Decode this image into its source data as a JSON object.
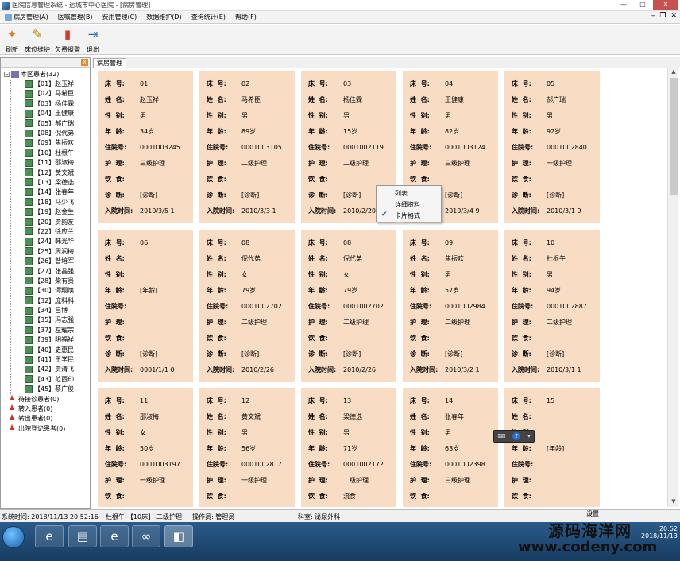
{
  "window": {
    "title": "医院信息管理系统 - 运城市中心医院 - [病房管理]"
  },
  "menu": [
    {
      "label": "病房管理(A)"
    },
    {
      "label": "医嘱管理(B)"
    },
    {
      "label": "费用管理(C)"
    },
    {
      "label": "数据维护(D)"
    },
    {
      "label": "查询统计(E)"
    },
    {
      "label": "帮助(F)"
    }
  ],
  "toolbar": [
    {
      "label": "刷新",
      "icon": "refresh-icon"
    },
    {
      "label": "床位维护",
      "icon": "bed-maintain-icon"
    },
    {
      "label": "欠费报警",
      "icon": "alarm-icon"
    },
    {
      "label": "退出",
      "icon": "exit-icon"
    }
  ],
  "tree": {
    "root": "本区患者(32)",
    "patients": [
      "【01】赵玉祥",
      "【02】马希臣",
      "【03】杨佳霖",
      "【04】王健康",
      "【05】郝广瑞",
      "【08】倪代弟",
      "【09】焦振欢",
      "【10】杜根午",
      "【11】邵淑梅",
      "【12】黄文斌",
      "【13】梁德选",
      "【14】张春年",
      "【18】马少飞",
      "【19】赵金生",
      "【20】贾韵友",
      "【22】徐应兰",
      "【24】韩光华",
      "【25】周润梅",
      "【26】昝培军",
      "【27】张晶强",
      "【28】柴有贵",
      "【30】谭翔焕",
      "【32】庞科科",
      "【34】吕博",
      "【35】冯志强",
      "【37】左耀宗",
      "【39】阴福祥",
      "【40】史惠民",
      "【41】王学民",
      "【42】贾清飞",
      "【43】范西印",
      "【45】蔡广俊"
    ],
    "groups": [
      "待接诊患者(0)",
      "转入患者(0)",
      "转出患者(0)",
      "出院登记患者(0)"
    ]
  },
  "tab": {
    "label": "病房管理"
  },
  "labels": {
    "bed": "床  号:",
    "name": "姓  名:",
    "gender": "性  别:",
    "age": "年  龄:",
    "inpatient_no": "住院号:",
    "nursing": "护  理:",
    "diet": "饮  食:",
    "diagnosis": "诊  断:",
    "admit_time": "入院时间:"
  },
  "cards": [
    {
      "bed": "01",
      "name": "赵玉祥",
      "gender": "男",
      "age": "34岁",
      "inpatient_no": "0001003245",
      "nursing": "三级护理",
      "diet": "",
      "diagnosis": "[诊断]",
      "admit_time": "2010/3/5 1"
    },
    {
      "bed": "02",
      "name": "马希臣",
      "gender": "男",
      "age": "89岁",
      "inpatient_no": "0001003105",
      "nursing": "二级护理",
      "diet": "",
      "diagnosis": "[诊断]",
      "admit_time": "2010/3/3 1"
    },
    {
      "bed": "03",
      "name": "杨佳霖",
      "gender": "男",
      "age": "15岁",
      "inpatient_no": "0001002119",
      "nursing": "二级护理",
      "diet": "",
      "diagnosis": "[诊断]",
      "admit_time": "2010/2/20"
    },
    {
      "bed": "04",
      "name": "王健康",
      "gender": "男",
      "age": "82岁",
      "inpatient_no": "0001003124",
      "nursing": "三级护理",
      "diet": "",
      "diagnosis": "[诊断]",
      "admit_time": "2010/3/4 9"
    },
    {
      "bed": "05",
      "name": "郝广瑞",
      "gender": "男",
      "age": "92岁",
      "inpatient_no": "0001002840",
      "nursing": "一级护理",
      "diet": "",
      "diagnosis": "[诊断]",
      "admit_time": "2010/3/1 9"
    },
    {
      "bed": "06",
      "name": "",
      "gender": "",
      "age": "[年龄]",
      "inpatient_no": "",
      "nursing": "",
      "diet": "",
      "diagnosis": "[诊断]",
      "admit_time": "0001/1/1 0"
    },
    {
      "bed": "08",
      "name": "倪代弟",
      "gender": "女",
      "age": "79岁",
      "inpatient_no": "0001002702",
      "nursing": "二级护理",
      "diet": "",
      "diagnosis": "[诊断]",
      "admit_time": "2010/2/26"
    },
    {
      "bed": "08",
      "name": "倪代弟",
      "gender": "女",
      "age": "79岁",
      "inpatient_no": "0001002702",
      "nursing": "二级护理",
      "diet": "",
      "diagnosis": "[诊断]",
      "admit_time": "2010/2/26"
    },
    {
      "bed": "09",
      "name": "焦振欢",
      "gender": "男",
      "age": "57岁",
      "inpatient_no": "0001002984",
      "nursing": "二级护理",
      "diet": "",
      "diagnosis": "[诊断]",
      "admit_time": "2010/3/2 1"
    },
    {
      "bed": "10",
      "name": "杜根午",
      "gender": "男",
      "age": "94岁",
      "inpatient_no": "0001002887",
      "nursing": "二级护理",
      "diet": "",
      "diagnosis": "[诊断]",
      "admit_time": "2010/3/1 1"
    },
    {
      "bed": "11",
      "name": "邵淑梅",
      "gender": "女",
      "age": "50岁",
      "inpatient_no": "0001003197",
      "nursing": "一级护理",
      "diet": "",
      "diagnosis": "",
      "admit_time": ""
    },
    {
      "bed": "12",
      "name": "黄文斌",
      "gender": "男",
      "age": "56岁",
      "inpatient_no": "0001002817",
      "nursing": "一级护理",
      "diet": "",
      "diagnosis": "",
      "admit_time": ""
    },
    {
      "bed": "13",
      "name": "梁德选",
      "gender": "男",
      "age": "71岁",
      "inpatient_no": "0001002172",
      "nursing": "二级护理",
      "diet": "流食",
      "diagnosis": "",
      "admit_time": ""
    },
    {
      "bed": "14",
      "name": "张春年",
      "gender": "男",
      "age": "63岁",
      "inpatient_no": "0001002398",
      "nursing": "三级护理",
      "diet": "",
      "diagnosis": "",
      "admit_time": ""
    },
    {
      "bed": "15",
      "name": "",
      "gender": "",
      "age": "[年龄]",
      "inpatient_no": "",
      "nursing": "",
      "diet": "",
      "diagnosis": "",
      "admit_time": ""
    }
  ],
  "context_menu": [
    {
      "label": "列表",
      "checked": false
    },
    {
      "label": "详细资料",
      "checked": false
    },
    {
      "label": "卡片格式",
      "checked": true
    }
  ],
  "status": {
    "time": "系统时间: 2018/11/13 20:52:16",
    "bed_info": "杜根午-【10床】-二级护理",
    "operator": "操作员: 管理员",
    "department": "科室: 泌尿外科",
    "settings": "设置"
  },
  "taskbar": {
    "clock_time": "20:52",
    "clock_date": "2018/11/13"
  },
  "watermark": {
    "line1": "源码海洋网",
    "line2": "www.codeny.com"
  }
}
